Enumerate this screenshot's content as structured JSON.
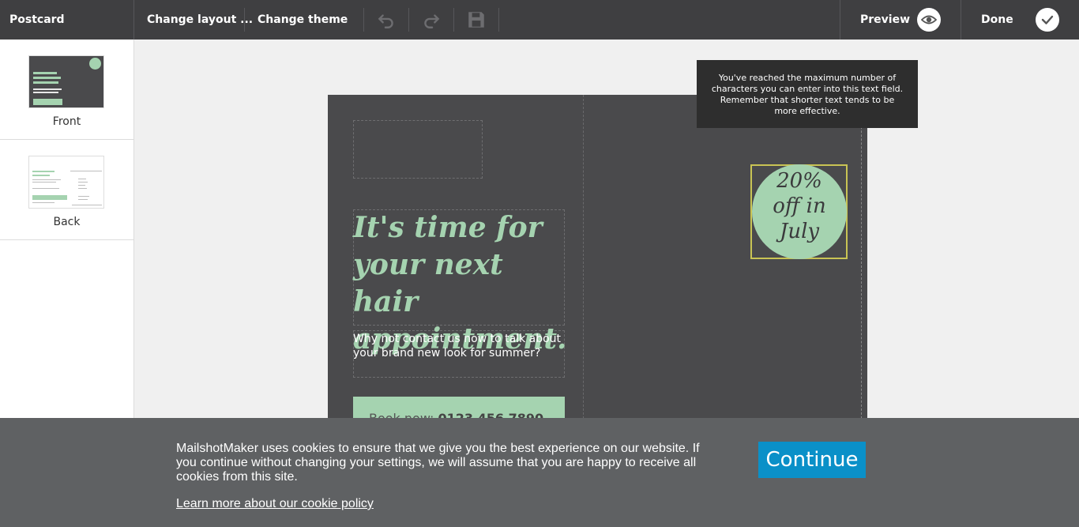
{
  "app": {
    "title": "Postcard"
  },
  "toolbar": {
    "change_layout": "Change layout ...",
    "change_theme": "Change theme",
    "undo_icon": "undo-icon",
    "redo_icon": "redo-icon",
    "save_icon": "save-icon",
    "preview": "Preview",
    "done": "Done"
  },
  "sidebar": {
    "pages": [
      {
        "label": "Front"
      },
      {
        "label": "Back"
      }
    ]
  },
  "postcard": {
    "headline": "It's time for your next hair appointment.",
    "subtext": "Why not contact us now to talk about your brand new look for summer?",
    "cta_prefix": "Book now:",
    "cta_phone": "0123 456 7890",
    "offer": "20%\noff in\nJuly",
    "colors": {
      "background": "#4a4a4c",
      "accent": "#a5d3b0"
    }
  },
  "tooltip": {
    "text": "You've reached the maximum number of characters you can enter into this text field. Remember that shorter text tends to be more effective."
  },
  "cookie_banner": {
    "message": "MailshotMaker uses cookies to ensure that we give you the best experience on our website. If you continue without changing your settings, we will assume that you are happy to receive all cookies from this site.",
    "link": "Learn more about our cookie policy",
    "button": "Continue",
    "button_color": "#0a90c8"
  }
}
